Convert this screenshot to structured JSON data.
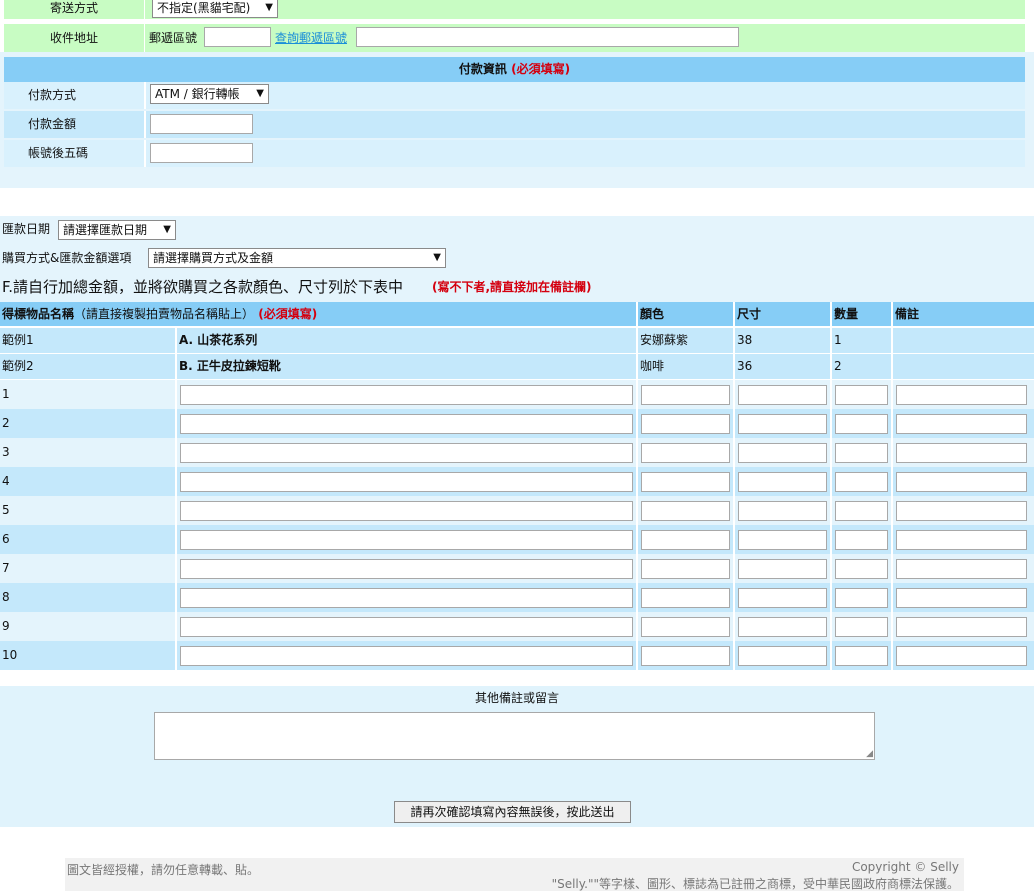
{
  "shipping": {
    "method_label": "寄送方式",
    "method_value": "不指定(黑貓宅配)",
    "address_label": "收件地址",
    "zip_label": "郵遞區號",
    "zip_lookup_link": "查詢郵遞區號"
  },
  "payment": {
    "section_title": "付款資訊",
    "section_required": "(必須填寫)",
    "method_label": "付款方式",
    "method_value": "ATM / 銀行轉帳",
    "amount_label": "付款金額",
    "account_label": "帳號後五碼"
  },
  "remit": {
    "date_label": "匯款日期",
    "date_value": "請選擇匯款日期",
    "option_label": "購買方式&匯款金額選項",
    "option_value": "請選擇購買方式及金額"
  },
  "instructions": {
    "text": "F.請自行加總金額，並將欲購買之各款顏色、尺寸列於下表中",
    "note": "(寫不下者,請直接加在備註欄)"
  },
  "table": {
    "headers": {
      "item": "得標物品名稱",
      "item_hint": "（請直接複製拍賣物品名稱貼上）",
      "item_required": "(必須填寫)",
      "color": "顏色",
      "size": "尺寸",
      "qty": "數量",
      "remark": "備註"
    },
    "examples": [
      {
        "label": "範例1",
        "item": "A. 山茶花系列",
        "color": "安娜蘇紫",
        "size": "38",
        "qty": "1",
        "remark": ""
      },
      {
        "label": "範例2",
        "item": "B. 正牛皮拉鍊短靴",
        "color": "咖啡",
        "size": "36",
        "qty": "2",
        "remark": ""
      }
    ],
    "rows": [
      "1",
      "2",
      "3",
      "4",
      "5",
      "6",
      "7",
      "8",
      "9",
      "10"
    ]
  },
  "notes": {
    "title": "其他備註或留言"
  },
  "submit_label": "請再次確認填寫內容無誤後，按此送出",
  "footer": {
    "left": "圖文皆經授權，請勿任意轉載、貼。",
    "copyright": "Copyright © Selly",
    "trademark": "\"Selly.\"\"等字樣、圖形、標誌為已註冊之商標，受中華民國政府商標法保護。"
  }
}
